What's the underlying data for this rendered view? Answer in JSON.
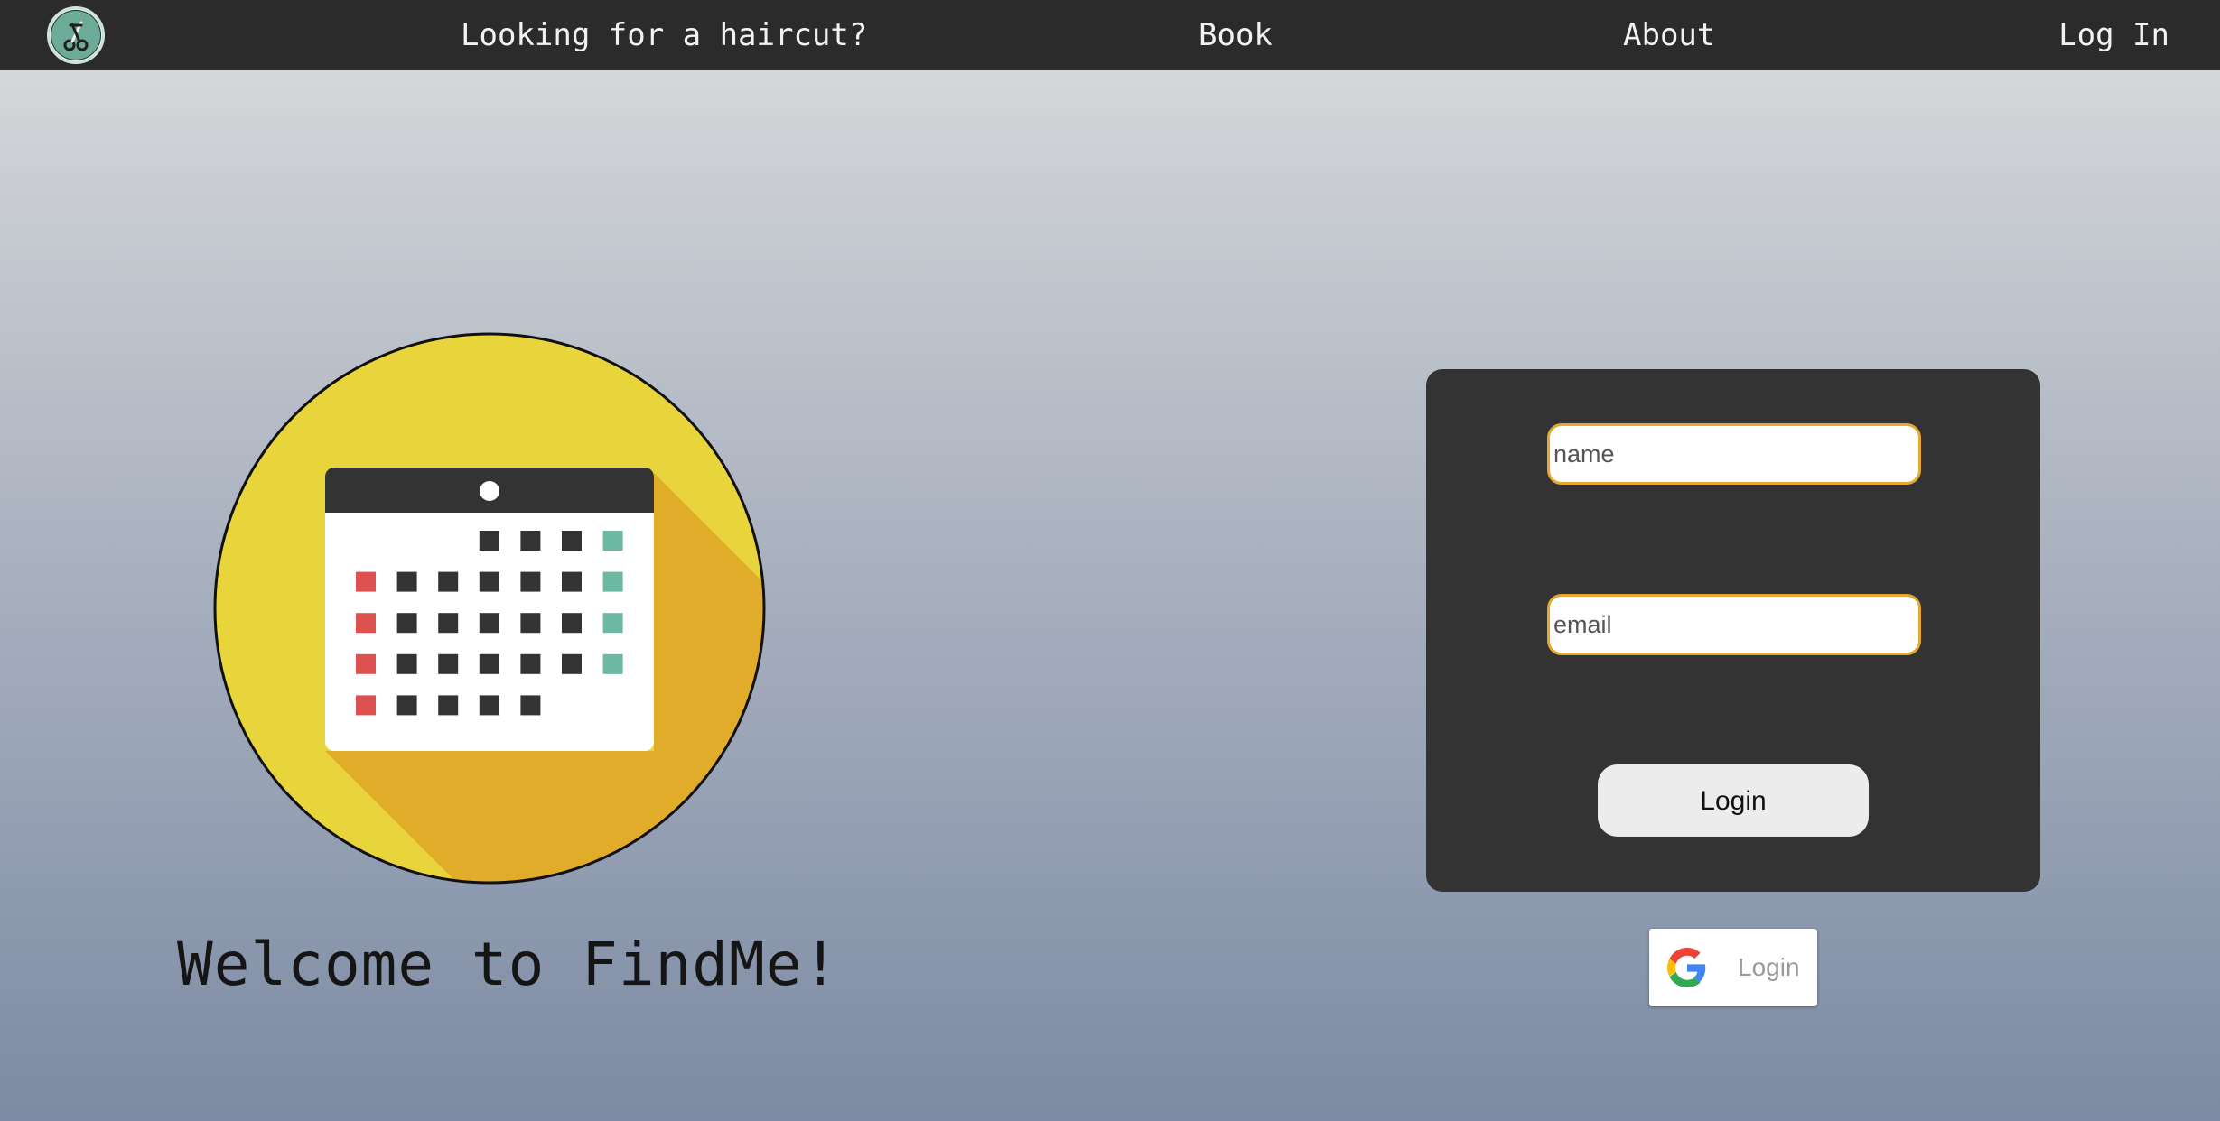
{
  "nav": {
    "tagline": "Looking for a haircut?",
    "book": "Book",
    "about": "About",
    "login": "Log In",
    "logo_icon": "scissors-icon"
  },
  "hero": {
    "illustration": "calendar-icon",
    "welcome": "Welcome to FindMe!"
  },
  "login_form": {
    "name_placeholder": "name",
    "email_placeholder": "email",
    "submit_label": "Login"
  },
  "google_login": {
    "icon": "google-icon",
    "label": "Login"
  },
  "colors": {
    "navbar": "#2b2b2b",
    "card": "#333333",
    "field_border": "#e6a82e",
    "circle_yellow": "#e8d53b",
    "circle_shadow": "#e0ac2a",
    "calendar_red": "#dd5151",
    "calendar_teal": "#6cb8a3",
    "calendar_dark": "#333333"
  }
}
